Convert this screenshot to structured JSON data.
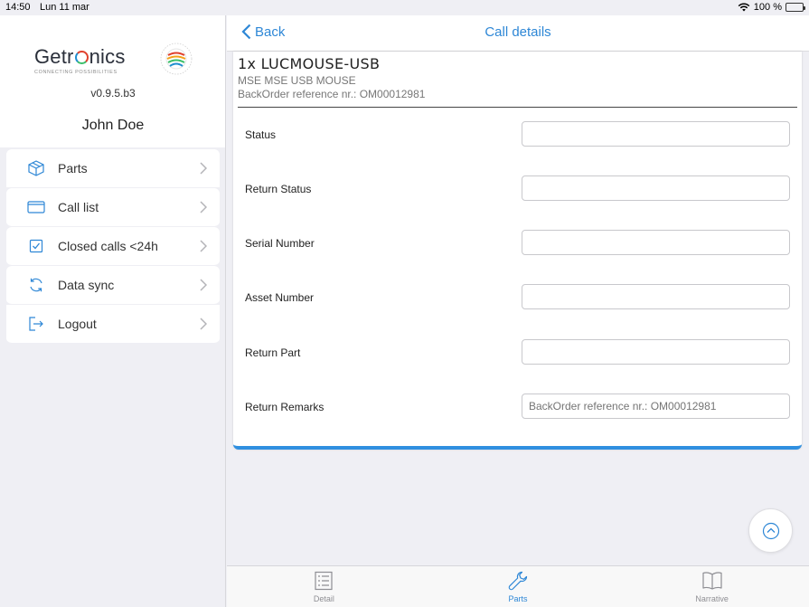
{
  "status_bar": {
    "time": "14:50",
    "date": "Lun 11 mar",
    "battery": "100 %"
  },
  "sidebar": {
    "logo": {
      "word_pre": "Getr",
      "word_post": "nics",
      "tagline": "CONNECTING POSSIBILITIES",
      "seal_text": "GLOBAL"
    },
    "version": "v0.9.5.b3",
    "user": "John Doe",
    "menu": [
      {
        "label": "Parts",
        "icon": "box-icon"
      },
      {
        "label": "Call list",
        "icon": "window-icon"
      },
      {
        "label": "Closed calls <24h",
        "icon": "checkbox-icon"
      },
      {
        "label": "Data sync",
        "icon": "sync-icon"
      },
      {
        "label": "Logout",
        "icon": "logout-icon"
      }
    ]
  },
  "navbar": {
    "back_label": "Back",
    "title": "Call details"
  },
  "part": {
    "title": "1x LUCMOUSE-USB",
    "description": "MSE MSE USB MOUSE",
    "backorder": "BackOrder reference nr.: OM00012981"
  },
  "form": {
    "fields": [
      {
        "label": "Status",
        "value": "",
        "placeholder": ""
      },
      {
        "label": "Return Status",
        "value": "",
        "placeholder": ""
      },
      {
        "label": "Serial Number",
        "value": "",
        "placeholder": ""
      },
      {
        "label": "Asset Number",
        "value": "",
        "placeholder": ""
      },
      {
        "label": "Return Part",
        "value": "",
        "placeholder": ""
      },
      {
        "label": "Return Remarks",
        "value": "",
        "placeholder": "BackOrder reference nr.: OM00012981"
      }
    ]
  },
  "tabbar": {
    "tabs": [
      {
        "label": "Detail",
        "icon": "list-icon",
        "active": false
      },
      {
        "label": "Parts",
        "icon": "wrench-icon",
        "active": true
      },
      {
        "label": "Narrative",
        "icon": "book-icon",
        "active": false
      }
    ]
  },
  "colors": {
    "accent": "#2e87d6",
    "card_border": "#2f8fe0",
    "background": "#efeff4"
  }
}
